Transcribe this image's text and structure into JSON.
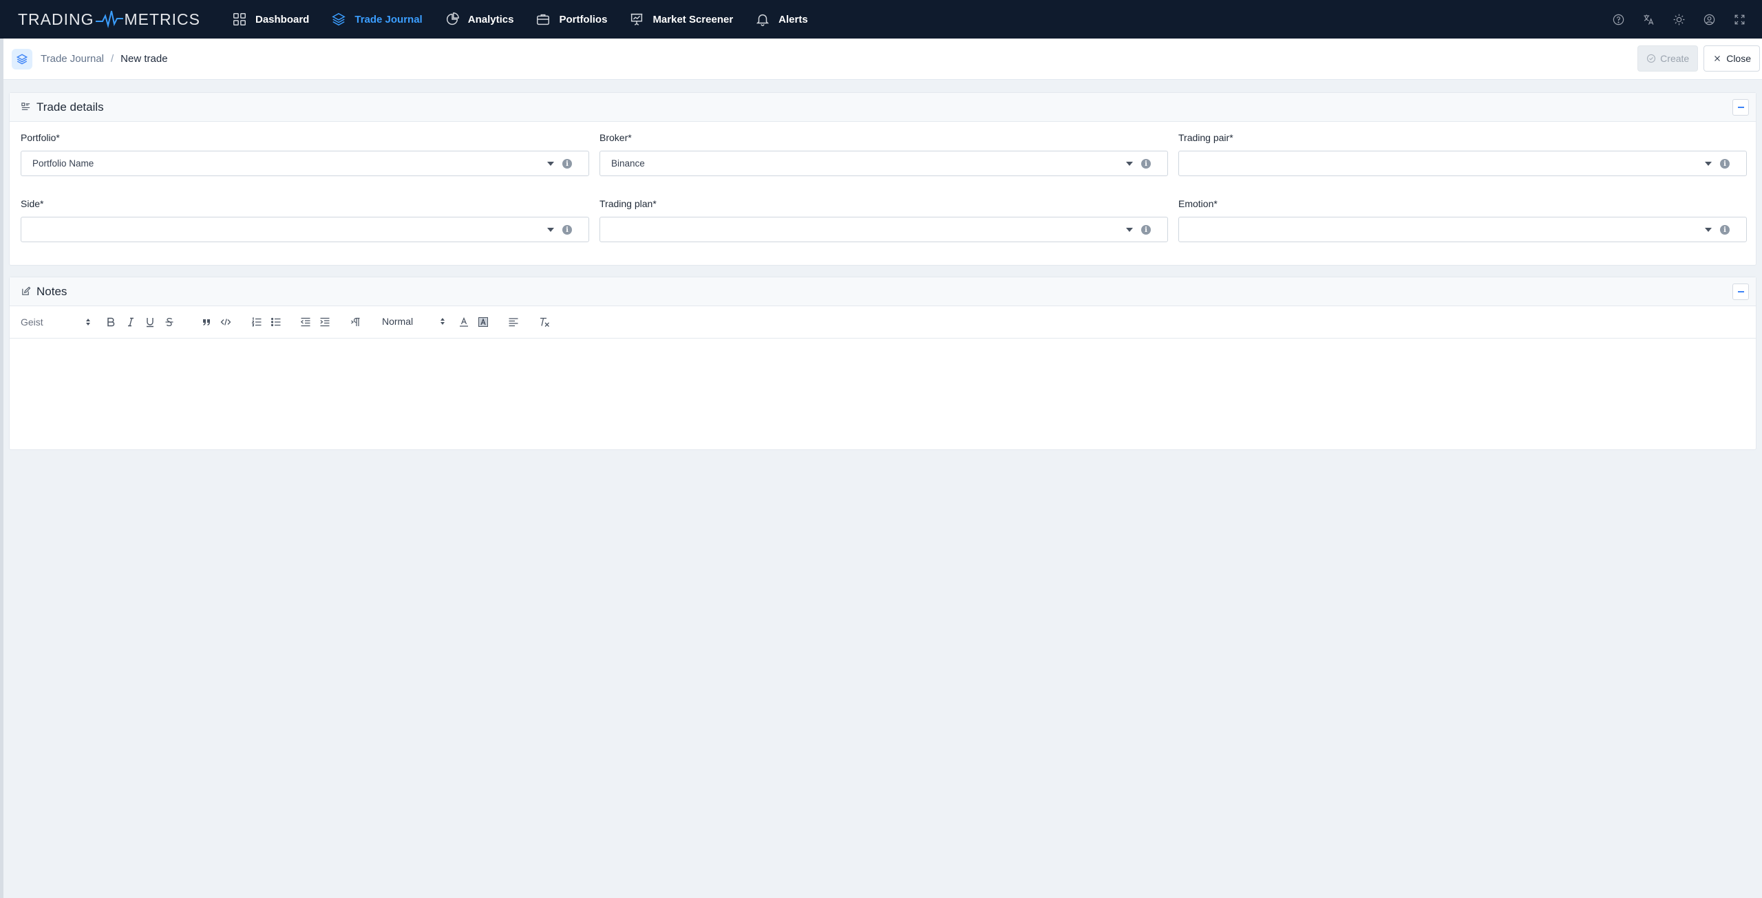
{
  "app": {
    "logo_left": "TRADING",
    "logo_right": "METRICS",
    "accent": "#3b9eff"
  },
  "nav": {
    "items": [
      {
        "label": "Dashboard",
        "icon": "grid-icon",
        "active": false
      },
      {
        "label": "Trade Journal",
        "icon": "layers-icon",
        "active": true
      },
      {
        "label": "Analytics",
        "icon": "pie-chart-icon",
        "active": false
      },
      {
        "label": "Portfolios",
        "icon": "briefcase-icon",
        "active": false
      },
      {
        "label": "Market Screener",
        "icon": "presentation-chart-icon",
        "active": false
      },
      {
        "label": "Alerts",
        "icon": "bell-icon",
        "active": false
      }
    ],
    "right_icons": [
      "help-icon",
      "translate-icon",
      "theme-sun-icon",
      "user-icon",
      "fullscreen-icon"
    ]
  },
  "breadcrumb": {
    "parent": "Trade Journal",
    "separator": "/",
    "current": "New trade"
  },
  "actions": {
    "create_label": "Create",
    "close_label": "Close"
  },
  "trade_details": {
    "title": "Trade details",
    "fields": {
      "portfolio": {
        "label": "Portfolio",
        "required": "*",
        "value": "Portfolio Name"
      },
      "broker": {
        "label": "Broker",
        "required": "*",
        "value": "Binance"
      },
      "trading_pair": {
        "label": "Trading pair",
        "required": "*",
        "value": ""
      },
      "side": {
        "label": "Side",
        "required": "*",
        "value": ""
      },
      "trading_plan": {
        "label": "Trading plan",
        "required": "*",
        "value": ""
      },
      "emotion": {
        "label": "Emotion",
        "required": "*",
        "value": ""
      }
    }
  },
  "notes": {
    "title": "Notes",
    "toolbar": {
      "font": "Geist",
      "size": "Normal"
    },
    "content": ""
  }
}
